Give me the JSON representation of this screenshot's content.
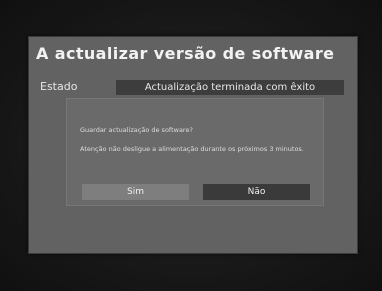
{
  "header": {
    "title": "A actualizar versão de software"
  },
  "status": {
    "label": "Estado",
    "value": "Actualização terminada com êxito"
  },
  "dialog": {
    "question": "Guardar actualização de software?",
    "warning": "Atenção não desligue a alimentação durante os próximos 3 minutos.",
    "yes_label": "Sim",
    "no_label": "Não"
  }
}
